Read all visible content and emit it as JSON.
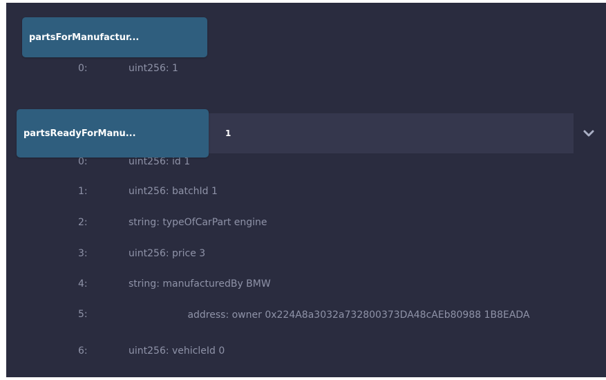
{
  "functions": [
    {
      "label": "partsForManufactur...",
      "outputs": [
        {
          "index": "0:",
          "value": "uint256: 1"
        }
      ]
    },
    {
      "label": "partsReadyForManu...",
      "input_value": "1",
      "outputs": [
        {
          "index": "0:",
          "value": "uint256: id 1"
        },
        {
          "index": "1:",
          "value": "uint256: batchId 1"
        },
        {
          "index": "2:",
          "value": "string: typeOfCarPart engine"
        },
        {
          "index": "3:",
          "value": "uint256: price 3"
        },
        {
          "index": "4:",
          "value": "string: manufacturedBy BMW"
        },
        {
          "index": "5:",
          "value": "address: owner 0x224A8a3032a732800373DA48cAEb80988 1B8EADA"
        },
        {
          "index": "6:",
          "value": "uint256: vehicleId 0"
        }
      ]
    }
  ],
  "icons": {
    "expand": "chevron-down-icon"
  },
  "colors": {
    "background": "#2a2c3f",
    "button": "#2f5e7e",
    "input": "#35374d",
    "text_muted": "#8f93a8"
  }
}
